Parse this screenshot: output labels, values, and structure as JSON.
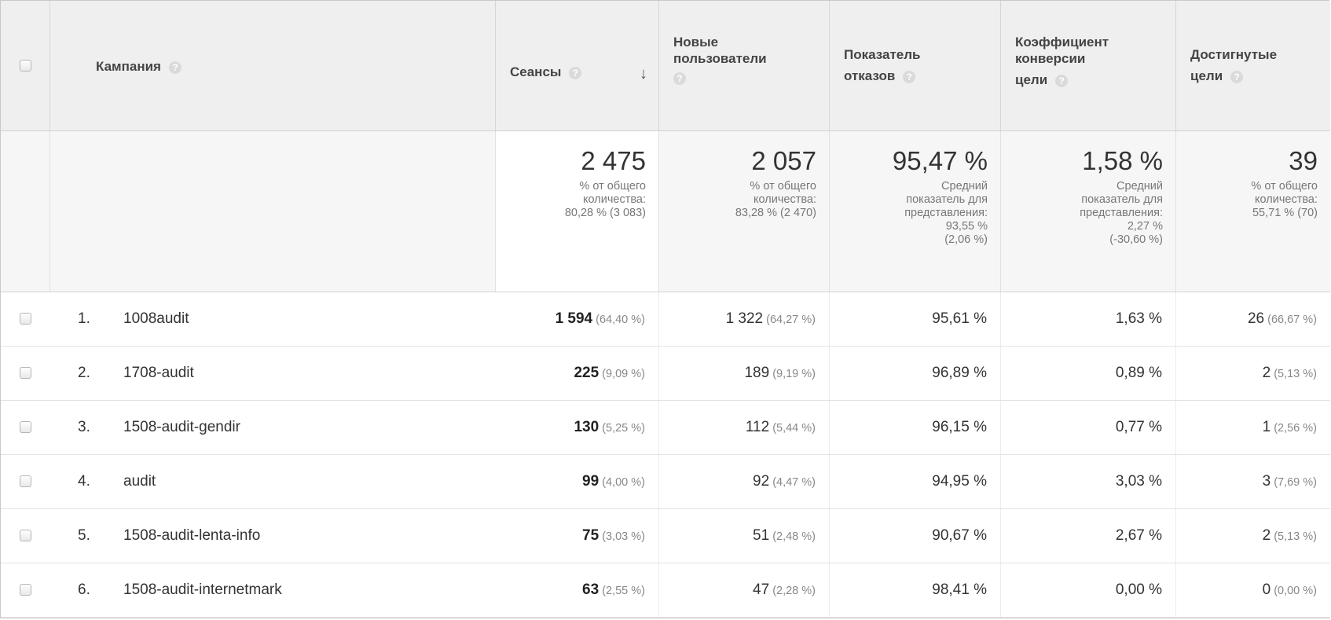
{
  "header": {
    "campaign_label": "Кампания",
    "sessions_label": "Сеансы",
    "new_users_line1": "Новые",
    "new_users_line2": "пользователи",
    "bounce_line1": "Показатель",
    "bounce_line2": "отказов",
    "conv_line1": "Коэффициент",
    "conv_line2": "конверсии",
    "conv_line3": "цели",
    "goals_line1": "Достигнутые",
    "goals_line2": "цели",
    "help_glyph": "?",
    "sort_glyph": "↓"
  },
  "totals": {
    "sessions": {
      "value": "2 475",
      "l1": "% от общего",
      "l2": "количества:",
      "l3": "80,28 % (3 083)"
    },
    "new_users": {
      "value": "2 057",
      "l1": "% от общего",
      "l2": "количества:",
      "l3": "83,28 % (2 470)"
    },
    "bounce": {
      "value": "95,47 %",
      "l1": "Средний",
      "l2": "показатель для",
      "l3": "представления:",
      "l4": "93,55 %",
      "l5": "(2,06 %)"
    },
    "conv": {
      "value": "1,58 %",
      "l1": "Средний",
      "l2": "показатель для",
      "l3": "представления:",
      "l4": "2,27 %",
      "l5": "(-30,60 %)"
    },
    "goals": {
      "value": "39",
      "l1": "% от общего",
      "l2": "количества:",
      "l3": "55,71 % (70)"
    }
  },
  "rows": [
    {
      "num": "1.",
      "name": "1008audit",
      "sessions": "1 594",
      "sessions_pct": "(64,40 %)",
      "new_users": "1 322",
      "new_users_pct": "(64,27 %)",
      "bounce": "95,61 %",
      "conv": "1,63 %",
      "goals": "26",
      "goals_pct": "(66,67 %)"
    },
    {
      "num": "2.",
      "name": "1708-audit",
      "sessions": "225",
      "sessions_pct": "(9,09 %)",
      "new_users": "189",
      "new_users_pct": "(9,19 %)",
      "bounce": "96,89 %",
      "conv": "0,89 %",
      "goals": "2",
      "goals_pct": "(5,13 %)"
    },
    {
      "num": "3.",
      "name": "1508-audit-gendir",
      "sessions": "130",
      "sessions_pct": "(5,25 %)",
      "new_users": "112",
      "new_users_pct": "(5,44 %)",
      "bounce": "96,15 %",
      "conv": "0,77 %",
      "goals": "1",
      "goals_pct": "(2,56 %)"
    },
    {
      "num": "4.",
      "name": "audit",
      "sessions": "99",
      "sessions_pct": "(4,00 %)",
      "new_users": "92",
      "new_users_pct": "(4,47 %)",
      "bounce": "94,95 %",
      "conv": "3,03 %",
      "goals": "3",
      "goals_pct": "(7,69 %)"
    },
    {
      "num": "5.",
      "name": "1508-audit-lenta-info",
      "sessions": "75",
      "sessions_pct": "(3,03 %)",
      "new_users": "51",
      "new_users_pct": "(2,48 %)",
      "bounce": "90,67 %",
      "conv": "2,67 %",
      "goals": "2",
      "goals_pct": "(5,13 %)"
    },
    {
      "num": "6.",
      "name": "1508-audit-internetmark",
      "sessions": "63",
      "sessions_pct": "(2,55 %)",
      "new_users": "47",
      "new_users_pct": "(2,28 %)",
      "bounce": "98,41 %",
      "conv": "0,00 %",
      "goals": "0",
      "goals_pct": "(0,00 %)"
    }
  ]
}
